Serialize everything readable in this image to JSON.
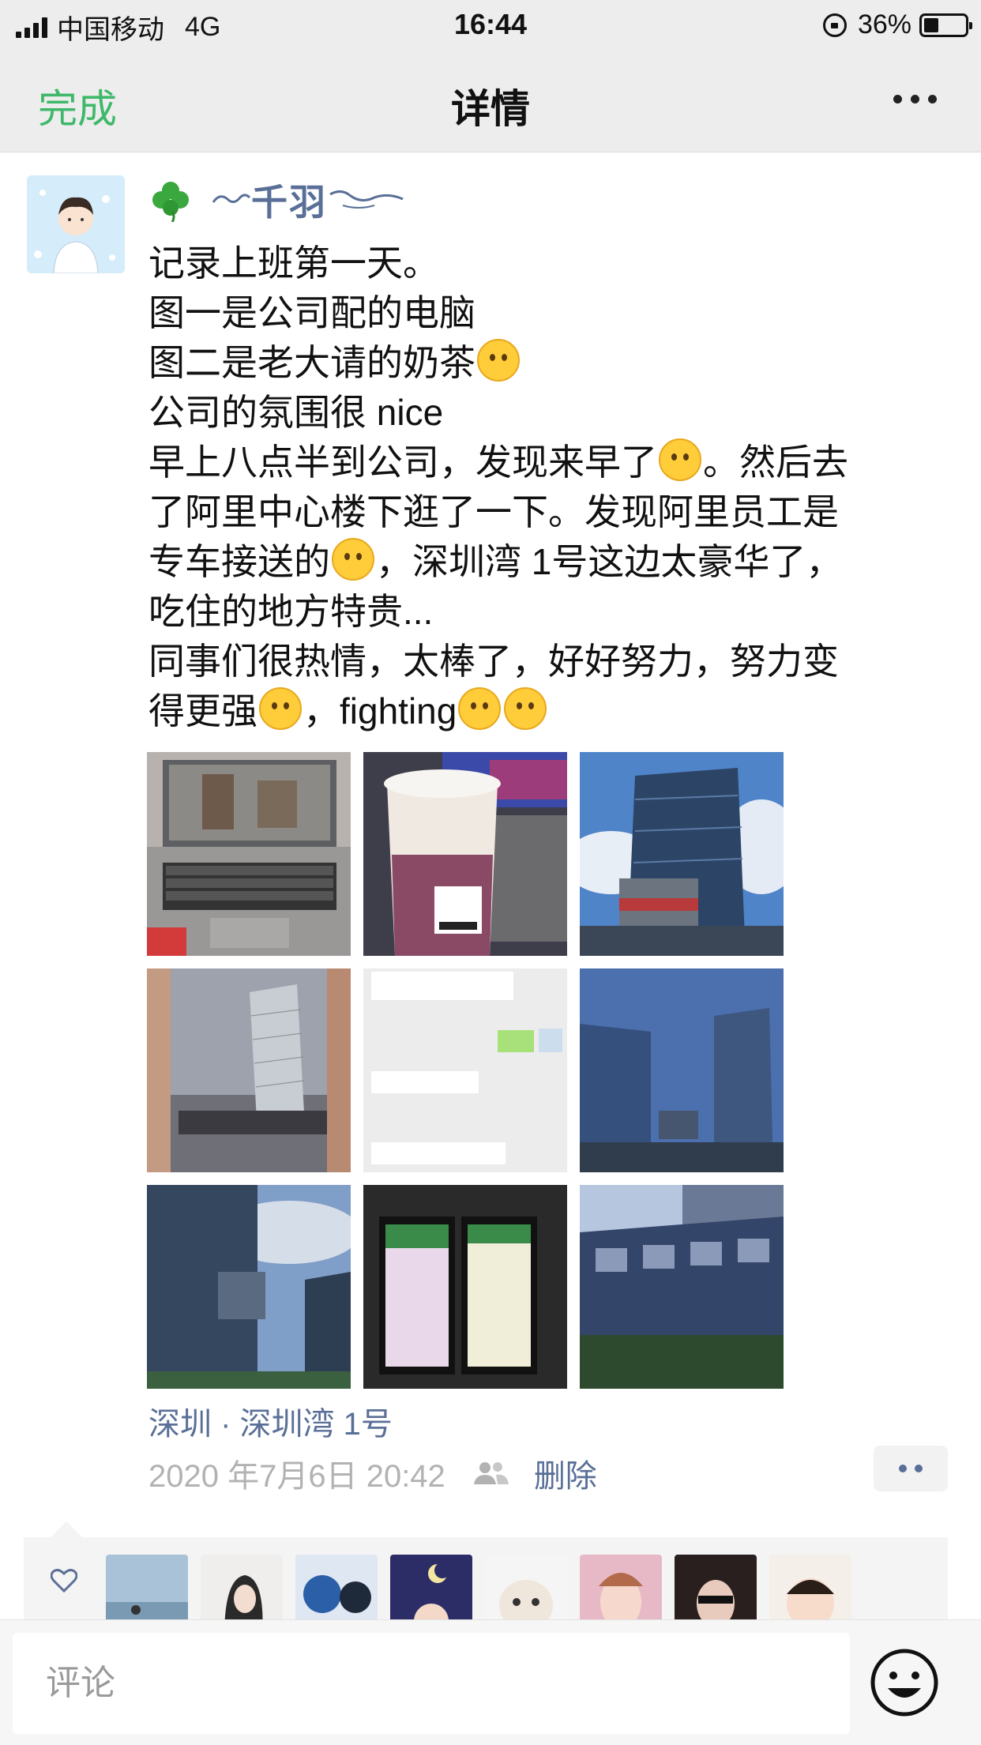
{
  "status_bar": {
    "carrier": "中国移动",
    "network": "4G",
    "time": "16:44",
    "battery": "36%",
    "battery_level": 0.36
  },
  "nav": {
    "done_label": "完成",
    "title": "详情",
    "more_icon": "more-icon"
  },
  "post": {
    "nickname": "千羽",
    "text_lines": [
      "记录上班第一天。",
      "图一是公司配的电脑",
      "图二是老大请的奶茶",
      "公司的氛围很 nice",
      "早上八点半到公司，发现来早了",
      "。然后去",
      "了阿里中心楼下逛了一下。发现阿里员工是",
      "专车接送的",
      "，深圳湾 1号这边太豪华了，",
      "吃住的地方特贵...",
      "同事们很热情，太棒了，好好努力，努力变",
      "得更强",
      "，fighting"
    ],
    "location": "深圳 · 深圳湾 1号",
    "timestamp": "2020 年7月6日 20:42",
    "delete_label": "删除"
  },
  "comment_bar": {
    "placeholder": "评论"
  },
  "colors": {
    "accent_green": "#3fb86a",
    "link_blue": "#5a6f97",
    "meta_gray": "#b2b2b2"
  }
}
